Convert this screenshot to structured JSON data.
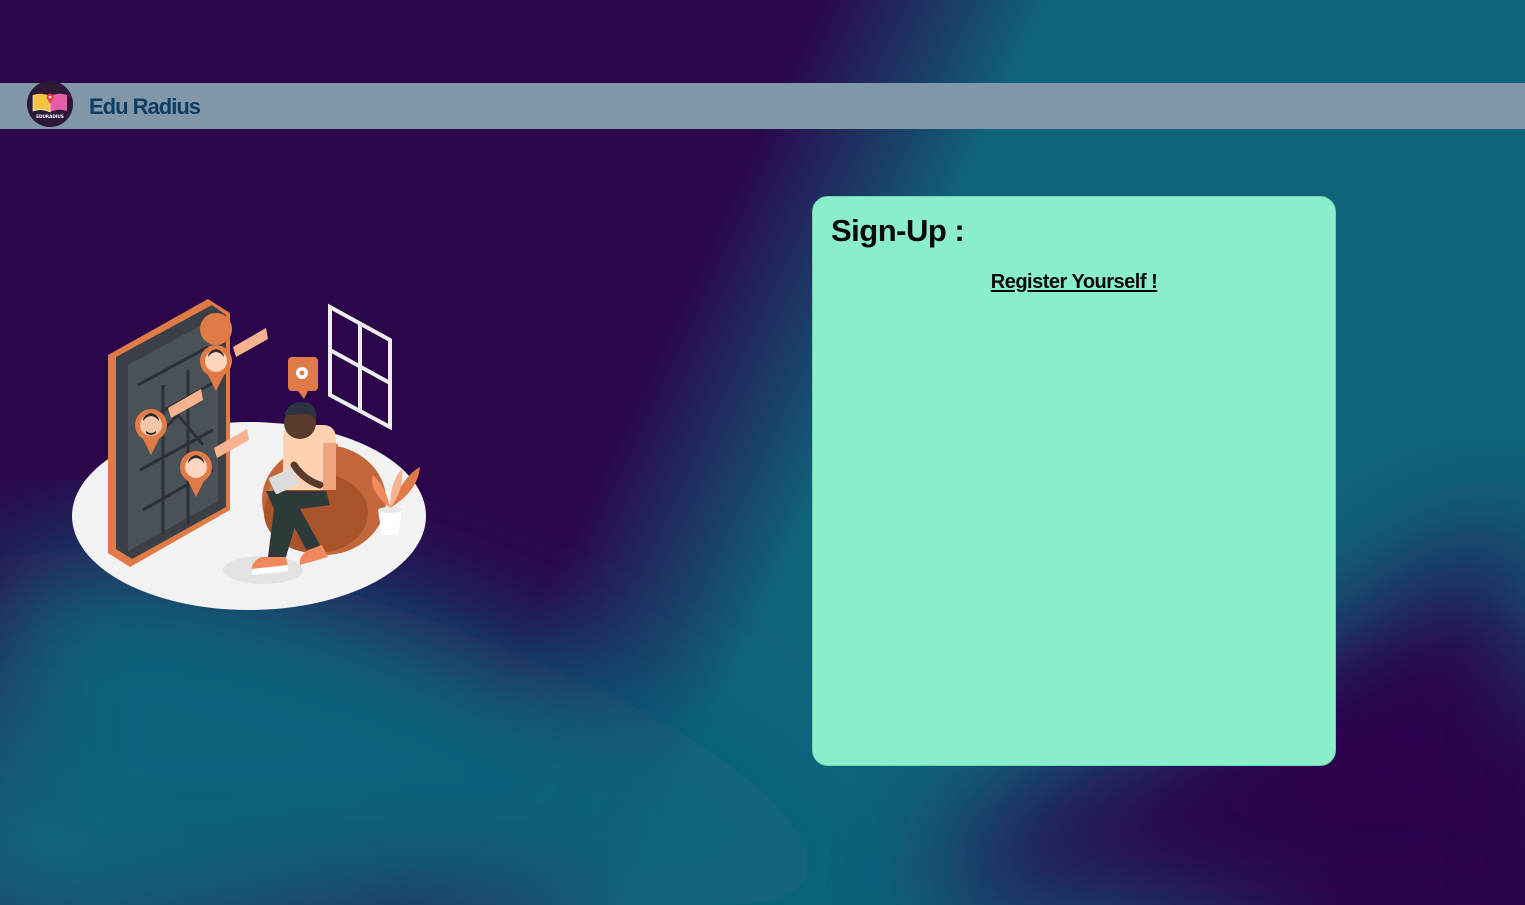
{
  "header": {
    "brand_name": "Edu Radius",
    "logo_text": "EDURADIUS"
  },
  "signup": {
    "title": "Sign-Up :",
    "subtitle": "Register Yourself !"
  },
  "colors": {
    "background_dark": "#2b064b",
    "background_teal": "#10647a",
    "navbar": "#8097aa",
    "brand_text": "#0f3c63",
    "card": "#8beecb",
    "illustration_accent": "#f08a5d"
  },
  "icons": {
    "logo": "open-book-map-pin-icon",
    "illustration": "person-with-map-locations-illustration"
  }
}
